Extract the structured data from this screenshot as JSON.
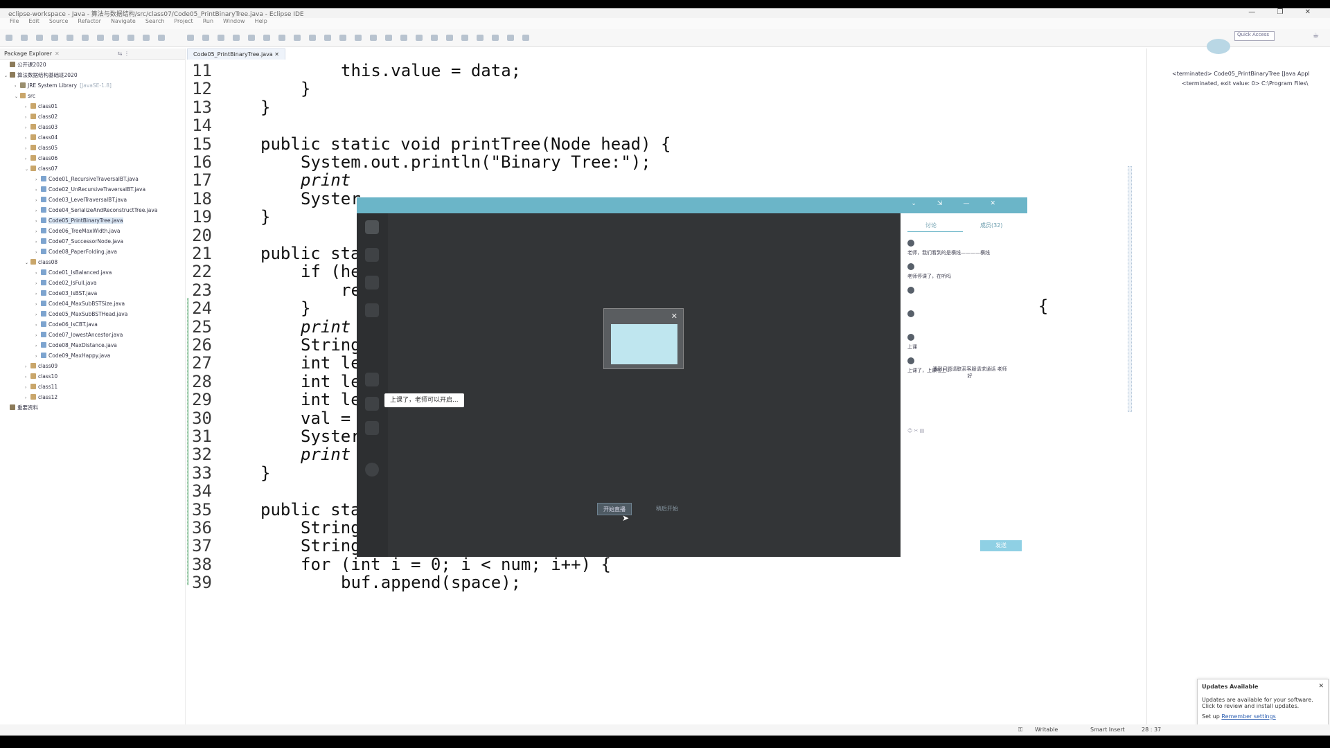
{
  "window": {
    "title": "eclipse-workspace - Java - 算法与数据结构/src/class07/Code05_PrintBinaryTree.java - Eclipse IDE",
    "controls": "— ❐ ✕"
  },
  "menu": [
    "File",
    "Edit",
    "Source",
    "Refactor",
    "Navigate",
    "Search",
    "Project",
    "Run",
    "Window",
    "Help"
  ],
  "toolbar": {
    "quick_access": "Quick Access"
  },
  "explorer": {
    "title": "Package Explorer",
    "close": "✕",
    "items": [
      {
        "indent": 0,
        "twisty": "",
        "icon": "prj",
        "label": "公开课2020",
        "dec": ""
      },
      {
        "indent": 0,
        "twisty": "⌄",
        "icon": "prj",
        "label": "算法数据结构基础班2020",
        "dec": ""
      },
      {
        "indent": 1,
        "twisty": "›",
        "icon": "lib",
        "label": "JRE System Library",
        "dec": "[JavaSE-1.8]"
      },
      {
        "indent": 1,
        "twisty": "⌄",
        "icon": "pkg",
        "label": "src",
        "dec": ""
      },
      {
        "indent": 2,
        "twisty": "›",
        "icon": "pkg",
        "label": "class01",
        "dec": ""
      },
      {
        "indent": 2,
        "twisty": "›",
        "icon": "pkg",
        "label": "class02",
        "dec": ""
      },
      {
        "indent": 2,
        "twisty": "›",
        "icon": "pkg",
        "label": "class03",
        "dec": ""
      },
      {
        "indent": 2,
        "twisty": "›",
        "icon": "pkg",
        "label": "class04",
        "dec": ""
      },
      {
        "indent": 2,
        "twisty": "›",
        "icon": "pkg",
        "label": "class05",
        "dec": ""
      },
      {
        "indent": 2,
        "twisty": "›",
        "icon": "pkg",
        "label": "class06",
        "dec": ""
      },
      {
        "indent": 2,
        "twisty": "⌄",
        "icon": "pkg",
        "label": "class07",
        "dec": ""
      },
      {
        "indent": 3,
        "twisty": "›",
        "icon": "jv",
        "label": "Code01_RecursiveTraversalBT.java",
        "dec": ""
      },
      {
        "indent": 3,
        "twisty": "›",
        "icon": "jv",
        "label": "Code02_UnRecursiveTraversalBT.java",
        "dec": ""
      },
      {
        "indent": 3,
        "twisty": "›",
        "icon": "jv",
        "label": "Code03_LevelTraversalBT.java",
        "dec": ""
      },
      {
        "indent": 3,
        "twisty": "›",
        "icon": "jv",
        "label": "Code04_SerializeAndReconstructTree.java",
        "dec": ""
      },
      {
        "indent": 3,
        "twisty": "›",
        "icon": "jv",
        "label": "Code05_PrintBinaryTree.java",
        "dec": "",
        "selected": true
      },
      {
        "indent": 3,
        "twisty": "›",
        "icon": "jv",
        "label": "Code06_TreeMaxWidth.java",
        "dec": ""
      },
      {
        "indent": 3,
        "twisty": "›",
        "icon": "jv",
        "label": "Code07_SuccessorNode.java",
        "dec": ""
      },
      {
        "indent": 3,
        "twisty": "›",
        "icon": "jv",
        "label": "Code08_PaperFolding.java",
        "dec": ""
      },
      {
        "indent": 2,
        "twisty": "⌄",
        "icon": "pkg",
        "label": "class08",
        "dec": ""
      },
      {
        "indent": 3,
        "twisty": "›",
        "icon": "jv",
        "label": "Code01_IsBalanced.java",
        "dec": ""
      },
      {
        "indent": 3,
        "twisty": "›",
        "icon": "jv",
        "label": "Code02_IsFull.java",
        "dec": ""
      },
      {
        "indent": 3,
        "twisty": "›",
        "icon": "jv",
        "label": "Code03_IsBST.java",
        "dec": ""
      },
      {
        "indent": 3,
        "twisty": "›",
        "icon": "jv",
        "label": "Code04_MaxSubBSTSize.java",
        "dec": ""
      },
      {
        "indent": 3,
        "twisty": "›",
        "icon": "jv",
        "label": "Code05_MaxSubBSTHead.java",
        "dec": ""
      },
      {
        "indent": 3,
        "twisty": "›",
        "icon": "jv",
        "label": "Code06_IsCBT.java",
        "dec": ""
      },
      {
        "indent": 3,
        "twisty": "›",
        "icon": "jv",
        "label": "Code07_lowestAncestor.java",
        "dec": ""
      },
      {
        "indent": 3,
        "twisty": "›",
        "icon": "jv",
        "label": "Code08_MaxDistance.java",
        "dec": ""
      },
      {
        "indent": 3,
        "twisty": "›",
        "icon": "jv",
        "label": "Code09_MaxHappy.java",
        "dec": ""
      },
      {
        "indent": 2,
        "twisty": "›",
        "icon": "pkg",
        "label": "class09",
        "dec": ""
      },
      {
        "indent": 2,
        "twisty": "›",
        "icon": "pkg",
        "label": "class10",
        "dec": ""
      },
      {
        "indent": 2,
        "twisty": "›",
        "icon": "pkg",
        "label": "class11",
        "dec": ""
      },
      {
        "indent": 2,
        "twisty": "›",
        "icon": "pkg",
        "label": "class12",
        "dec": ""
      },
      {
        "indent": 0,
        "twisty": "",
        "icon": "prj",
        "label": "重要资料",
        "dec": ""
      }
    ]
  },
  "editor": {
    "tab": "Code05_PrintBinaryTree.java ✕",
    "lines": [
      {
        "n": "11",
        "indent": 2,
        "text": "this.value = data;",
        "italic": false
      },
      {
        "n": "12",
        "indent": 1,
        "text": "}",
        "italic": false
      },
      {
        "n": "13",
        "indent": 0,
        "text": "}",
        "italic": false
      },
      {
        "n": "14",
        "indent": 0,
        "text": "",
        "italic": false
      },
      {
        "n": "15",
        "indent": 0,
        "text": "public static void printTree(Node head) {",
        "italic": false
      },
      {
        "n": "16",
        "indent": 1,
        "text": "System.out.println(\"Binary Tree:\");",
        "italic": false
      },
      {
        "n": "17",
        "indent": 1,
        "text": "print",
        "italic": true
      },
      {
        "n": "18",
        "indent": 1,
        "text": "Syster",
        "italic": false
      },
      {
        "n": "19",
        "indent": 0,
        "text": "}",
        "italic": false
      },
      {
        "n": "20",
        "indent": 0,
        "text": "",
        "italic": false
      },
      {
        "n": "21",
        "indent": 0,
        "text": "public sta",
        "italic": false
      },
      {
        "n": "22",
        "indent": 1,
        "text": "if (he",
        "italic": false
      },
      {
        "n": "23",
        "indent": 2,
        "text": "re",
        "italic": false
      },
      {
        "n": "24",
        "indent": 1,
        "text": "}",
        "italic": false
      },
      {
        "n": "25",
        "indent": 1,
        "text": "print",
        "italic": true
      },
      {
        "n": "26",
        "indent": 1,
        "text": "String",
        "italic": false
      },
      {
        "n": "27",
        "indent": 1,
        "text": "int le",
        "italic": false
      },
      {
        "n": "28",
        "indent": 1,
        "text": "int le",
        "italic": false
      },
      {
        "n": "29",
        "indent": 1,
        "text": "int le",
        "italic": false
      },
      {
        "n": "30",
        "indent": 1,
        "text": "val =",
        "italic": false
      },
      {
        "n": "31",
        "indent": 1,
        "text": "Syster",
        "italic": false
      },
      {
        "n": "32",
        "indent": 1,
        "text": "print",
        "italic": true
      },
      {
        "n": "33",
        "indent": 0,
        "text": "}",
        "italic": false
      },
      {
        "n": "34",
        "indent": 0,
        "text": "",
        "italic": false
      },
      {
        "n": "35",
        "indent": 0,
        "text": "public static String getSpace(int num) {",
        "italic": false
      },
      {
        "n": "36",
        "indent": 1,
        "text": "String space = \" \";",
        "italic": false
      },
      {
        "n": "37",
        "indent": 1,
        "text": "StringBuffer buf = new StringBuffer(\"\");",
        "italic": false
      },
      {
        "n": "38",
        "indent": 1,
        "text": "for (int i = 0; i < num; i++) {",
        "italic": false
      },
      {
        "n": "39",
        "indent": 2,
        "text": "buf.append(space);",
        "italic": false
      }
    ],
    "hidden_fragment": ") {"
  },
  "console": {
    "line1": "<terminated> Code05_PrintBinaryTree [Java Appl",
    "line2": "<terminated, exit value: 0> C:\\Program Files\\"
  },
  "overlay": {
    "tooltip": "上课了，老师可以开启...",
    "start_button": "开始直播",
    "alt_button": "稍后开始",
    "side_tabs": [
      "讨论",
      "成员(32)"
    ],
    "messages": [
      "老师，我们看到的是横线————横线",
      "老师停课了，在听吗",
      "",
      "",
      "上课",
      "上课了，上课啦上..."
    ],
    "notice": "遇到问题请联系客服请求通话 老师好",
    "send": "发送"
  },
  "notification": {
    "title": "Updates Available",
    "body": "Updates are available for your software. Click to review and install updates.",
    "link_prefix": "Set up",
    "link": "Remember settings"
  },
  "status": {
    "writable": "Writable",
    "insert": "Smart Insert",
    "pos": "28 : 37"
  },
  "colors": {
    "accent": "#6bb5c8",
    "dark_bg": "#333537"
  }
}
